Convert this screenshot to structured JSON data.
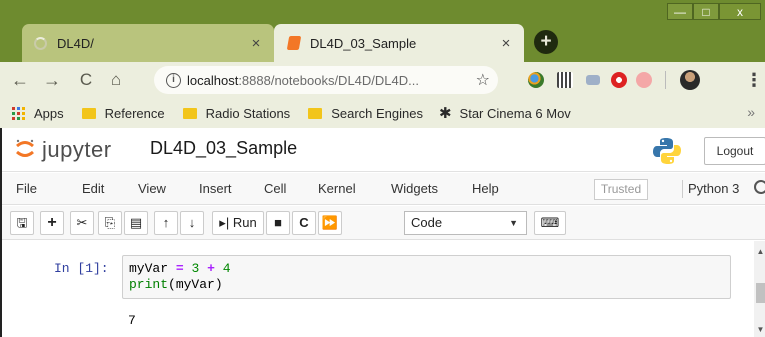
{
  "browser": {
    "tabs": [
      {
        "title": "DL4D/",
        "close": "×"
      },
      {
        "title": "DL4D_03_Sample",
        "close": "×"
      }
    ],
    "new_tab": "+",
    "window_controls": {
      "minimize": "—",
      "maximize": "□",
      "close": "x"
    },
    "url_host": "localhost",
    "url_path": ":8888/notebooks/DL4D/DL4D...",
    "bookmarks": [
      "Apps",
      "Reference",
      "Radio Stations",
      "Search Engines",
      "Star Cinema 6 Mov"
    ],
    "bookmarks_more": "»"
  },
  "jupyter": {
    "logo_text": "jupyter",
    "notebook_name": "DL4D_03_Sample",
    "logout_label": "Logout",
    "menus": [
      "File",
      "Edit",
      "View",
      "Insert",
      "Cell",
      "Kernel",
      "Widgets",
      "Help"
    ],
    "trusted_label": "Trusted",
    "kernel_name": "Python 3",
    "toolbar": {
      "run_label": "Run",
      "cell_type": "Code"
    },
    "cell": {
      "prompt": "In [1]:",
      "code_line1": {
        "var": "myVar",
        "eq": "=",
        "a": "3",
        "plus": "+",
        "b": "4"
      },
      "code_line2": {
        "fn": "print",
        "arg": "(myVar)"
      },
      "output": "7"
    }
  },
  "colors": {
    "tabstrip": "#6e8b2f",
    "chrome_bg": "#eceede",
    "prompt_blue": "#303f9f",
    "jupyter_orange": "#f37726"
  }
}
